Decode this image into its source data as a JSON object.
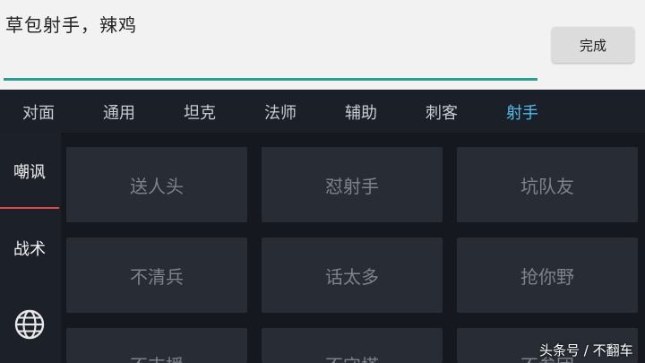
{
  "input": {
    "text": "草包射手，辣鸡"
  },
  "done_button": {
    "label": "完成"
  },
  "tabs": [
    {
      "label": "对面"
    },
    {
      "label": "通用"
    },
    {
      "label": "坦克"
    },
    {
      "label": "法师"
    },
    {
      "label": "辅助"
    },
    {
      "label": "刺客"
    },
    {
      "label": "射手",
      "active": true
    }
  ],
  "sidebar": {
    "items": [
      {
        "label": "嘲讽",
        "selected": true
      },
      {
        "label": "战术"
      }
    ],
    "globe_icon": "globe-icon"
  },
  "phrases": [
    "送人头",
    "怼射手",
    "坑队友",
    "不清兵",
    "话太多",
    "抢你野",
    "不支援",
    "不守塔",
    "不参团"
  ],
  "watermark": {
    "text": "头条号 / 不翻车"
  },
  "colors": {
    "accent_underline": "#2a9d8f",
    "active_tab": "#52bde8",
    "selected_indicator": "#e04848"
  }
}
